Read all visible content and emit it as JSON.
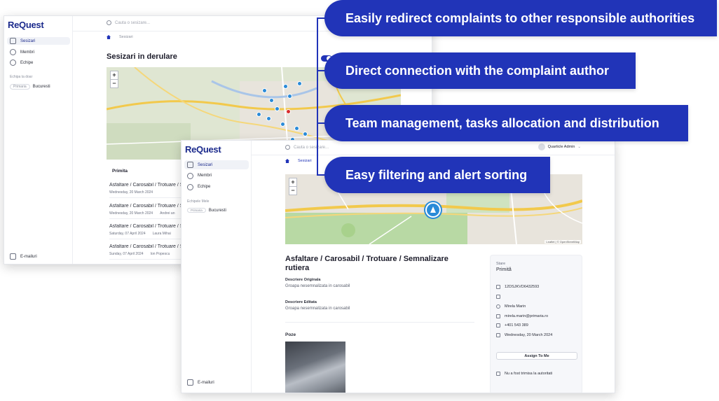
{
  "back_window": {
    "logo": "ReQuest",
    "search_placeholder": "Cauta o sesizare...",
    "nav": [
      {
        "label": "Sesizari",
        "active": true
      },
      {
        "label": "Membri",
        "active": false
      },
      {
        "label": "Echipe",
        "active": false
      }
    ],
    "section_label": "Echipa ta doar",
    "chip": "Primaria",
    "city": "Bucuresti",
    "footer_item": "E-mailuri",
    "breadcrumb": "Sesizari",
    "page_title": "Sesizari in derulare",
    "list_header": "Primita",
    "rows": [
      {
        "title": "Asfaltare / Carosabil / Trotuare / Sem",
        "date": "Wednesday, 20 March 2024",
        "person": ""
      },
      {
        "title": "Asfaltare / Carosabil / Trotuare / Sem",
        "date": "Wednesday, 20 March 2024",
        "person": "Andrei an"
      },
      {
        "title": "Asfaltare / Carosabil / Trotuare / Sem",
        "date": "Saturday, 07 April 2024",
        "person": "Laura Mihai"
      },
      {
        "title": "Asfaltare / Carosabil / Trotuare / Sem",
        "date": "Sunday, 07 April 2024",
        "person": "Ion Popescu"
      }
    ]
  },
  "front_window": {
    "logo": "ReQuest",
    "search_placeholder": "Cauta o sesizare...",
    "user_name": "Quarticle Admin",
    "nav": [
      {
        "label": "Sesizari",
        "active": true
      },
      {
        "label": "Membri",
        "active": false
      },
      {
        "label": "Echipe",
        "active": false
      }
    ],
    "section_label": "Echipele Mele",
    "chip": "Primaria",
    "city": "Bucuresti",
    "footer_item": "E-mailuri",
    "breadcrumb": "Sesizari",
    "map_attribution": "Leaflet | © OpenStreetMap",
    "detail": {
      "title": "Asfaltare / Carosabil / Trotuare / Semnalizare rutiera",
      "orig_label": "Descriere Originala",
      "orig_value": "Groapa nesemnalizata in carosabil",
      "edit_label": "Descriere Editata",
      "edit_value": "Groapa nesemnalizata in carosabil",
      "photos_label": "Poze"
    },
    "info": {
      "status_label": "Stare",
      "status_value": "Primită",
      "id": "12DSJKVD6432593",
      "author_name": "Mirela Marin",
      "author_email": "mirela.marin@primaria.ro",
      "phone": "+401 543 389",
      "date": "Wednesday, 20 March 2024",
      "assign_button": "Assign To Me",
      "note": "Nu a fost trimisa la autoritati"
    }
  },
  "callouts": [
    "Easily redirect complaints to other responsible authorities",
    "Direct connection with the complaint author",
    "Team management, tasks  allocation and distribution",
    "Easy filtering and alert sorting"
  ],
  "colors": {
    "brand": "#2134b8",
    "logo": "#1b2a8c",
    "pin": "#2a8bd8",
    "alert": "#d92d2d"
  },
  "icons": {
    "home": "home-icon",
    "search": "search-icon",
    "flag": "flag-icon",
    "user": "user-icon",
    "team": "team-icon",
    "mail": "mail-icon"
  }
}
